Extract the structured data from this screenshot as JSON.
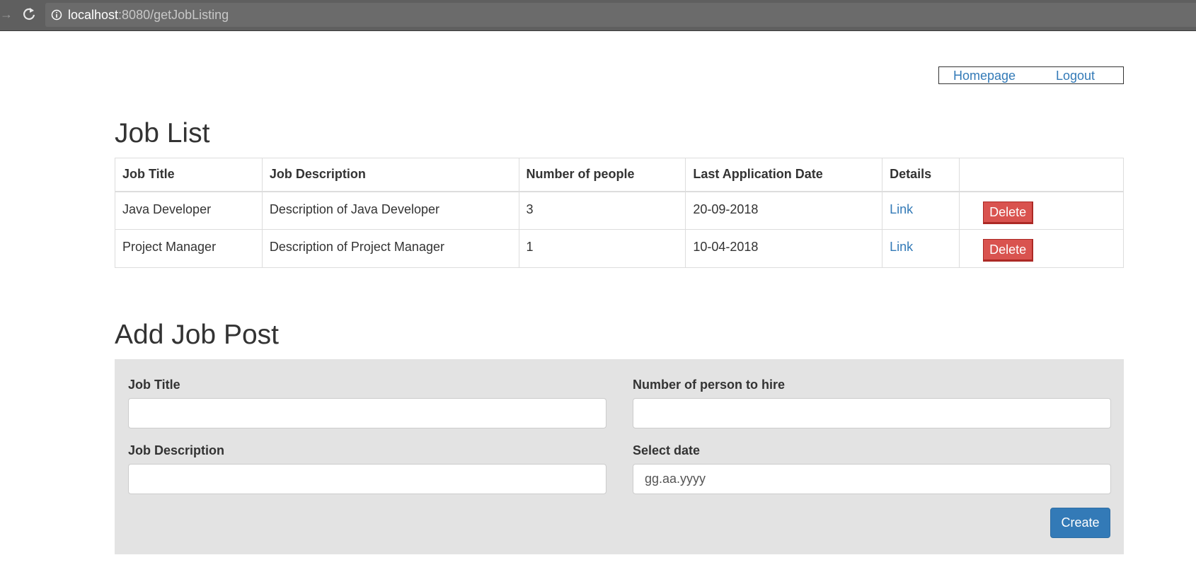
{
  "browser": {
    "url_host": "localhost",
    "url_rest": ":8080/getJobListing"
  },
  "topnav": {
    "homepage": "Homepage",
    "logout": "Logout"
  },
  "job_list": {
    "title": "Job List",
    "columns": [
      "Job Title",
      "Job Description",
      "Number of people",
      "Last Application Date",
      "Details",
      ""
    ],
    "rows": [
      {
        "title": "Java Developer",
        "description": "Description of Java Developer",
        "people": "3",
        "date": "20-09-2018",
        "details": "Link",
        "action": "Delete"
      },
      {
        "title": "Project Manager",
        "description": "Description of Project Manager",
        "people": "1",
        "date": "10-04-2018",
        "details": "Link",
        "action": "Delete"
      }
    ]
  },
  "add_job": {
    "title": "Add Job Post",
    "job_title_label": "Job Title",
    "job_title_value": "",
    "job_desc_label": "Job Description",
    "job_desc_value": "",
    "num_label": "Number of person to hire",
    "num_value": "",
    "date_label": "Select date",
    "date_placeholder": "gg.aa.yyyy",
    "create_label": "Create"
  },
  "colors": {
    "link": "#337ab7",
    "danger": "#d9534f",
    "primary": "#337ab7",
    "panel": "#e3e3e3"
  }
}
